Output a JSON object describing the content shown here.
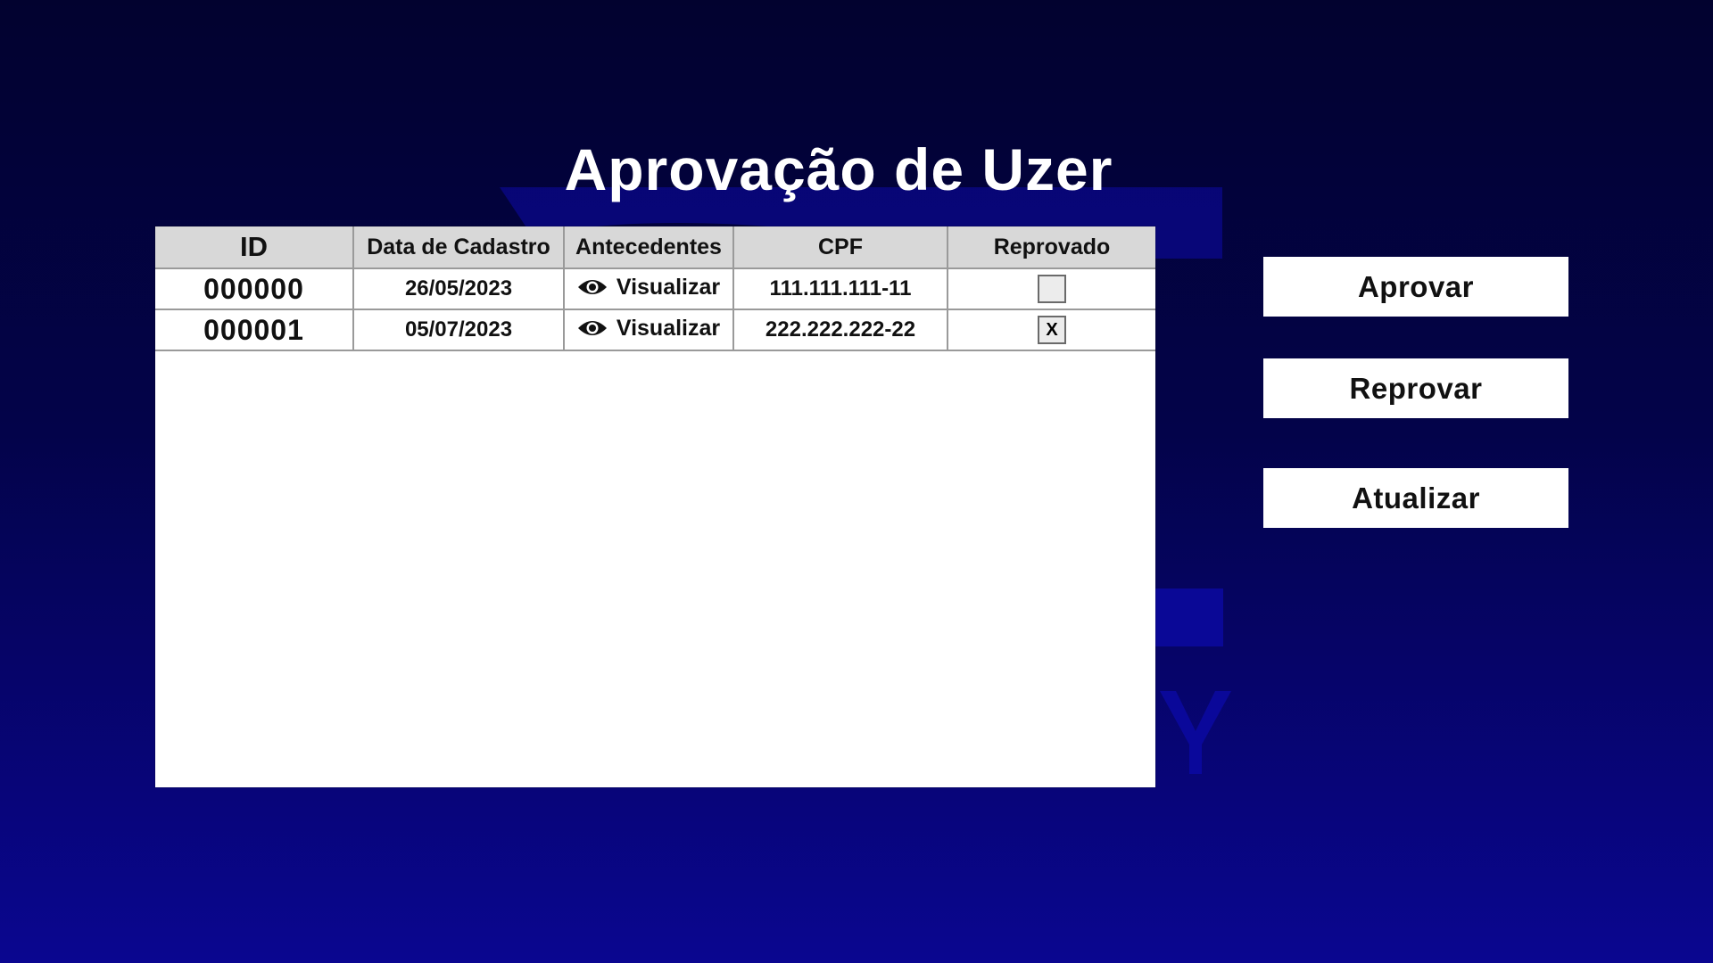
{
  "page": {
    "title": "Aprovação de Uzer"
  },
  "colors": {
    "background_top": "#02022f",
    "background_bottom": "#0a0690",
    "watermark": "#0c09a8",
    "header_bg": "#d8d8d8"
  },
  "table": {
    "columns": [
      "ID",
      "Data de Cadastro",
      "Antecedentes",
      "CPF",
      "Reprovado"
    ],
    "rows": [
      {
        "id": "000000",
        "date": "26/05/2023",
        "antecedentes": "Visualizar",
        "antecedentes_icon": "eye-icon",
        "cpf": "111.111.111-11",
        "reprovado": ""
      },
      {
        "id": "000001",
        "date": "05/07/2023",
        "antecedentes": "Visualizar",
        "antecedentes_icon": "eye-icon",
        "cpf": "222.222.222-22",
        "reprovado": "X"
      }
    ]
  },
  "actions": {
    "approve_label": "Aprovar",
    "reject_label": "Reprovar",
    "refresh_label": "Atualizar"
  }
}
